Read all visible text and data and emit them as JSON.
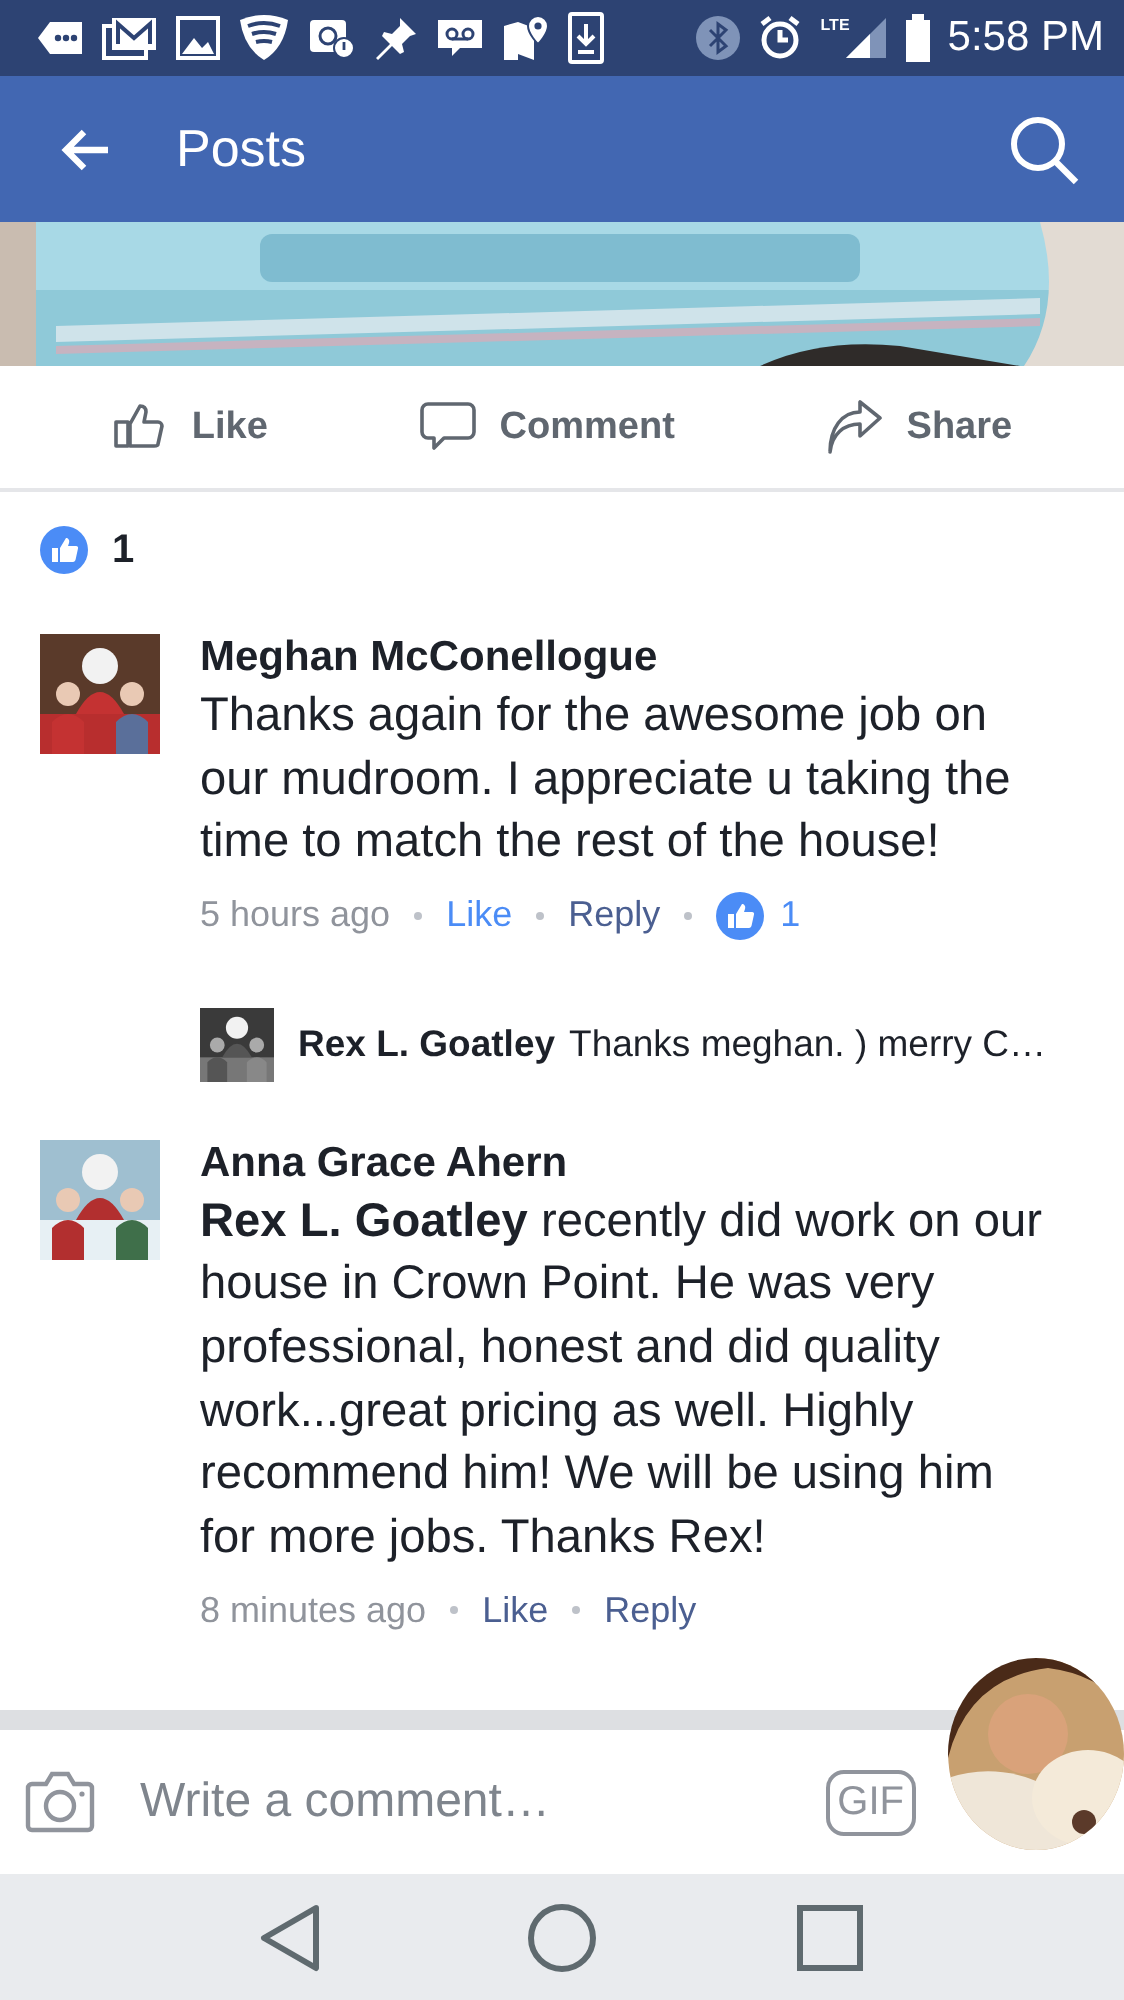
{
  "status_bar": {
    "network": "LTE",
    "time": "5:58 PM"
  },
  "app_bar": {
    "title": "Posts"
  },
  "post_actions": [
    {
      "kind": "like",
      "label": "Like"
    },
    {
      "kind": "comment",
      "label": "Comment"
    },
    {
      "kind": "share",
      "label": "Share"
    }
  ],
  "reactions": {
    "count": "1"
  },
  "comments": [
    {
      "author": "Meghan McConellogue",
      "text": "Thanks again for the awesome job on our mudroom. I appreciate u taking the time to match the rest of the house!",
      "time": "5 hours ago",
      "like": {
        "label": "Like",
        "selected": true
      },
      "reply": "Reply",
      "reaction_count": "1",
      "replies": [
        {
          "author": "Rex L. Goatley",
          "text": "Thanks meghan. )  merry C…"
        }
      ]
    },
    {
      "author": "Anna Grace Ahern",
      "text": "**Rex L. Goatley** recently did work on our house in Crown Point. He was very professional, honest and did quality work...great pricing as well. Highly recommend him! We will be using him for more jobs. Thanks Rex!",
      "time": "8 minutes ago",
      "like": {
        "label": "Like",
        "selected": false
      },
      "reply": "Reply"
    }
  ],
  "composer": {
    "placeholder": "Write a comment…",
    "gif": "GIF"
  }
}
